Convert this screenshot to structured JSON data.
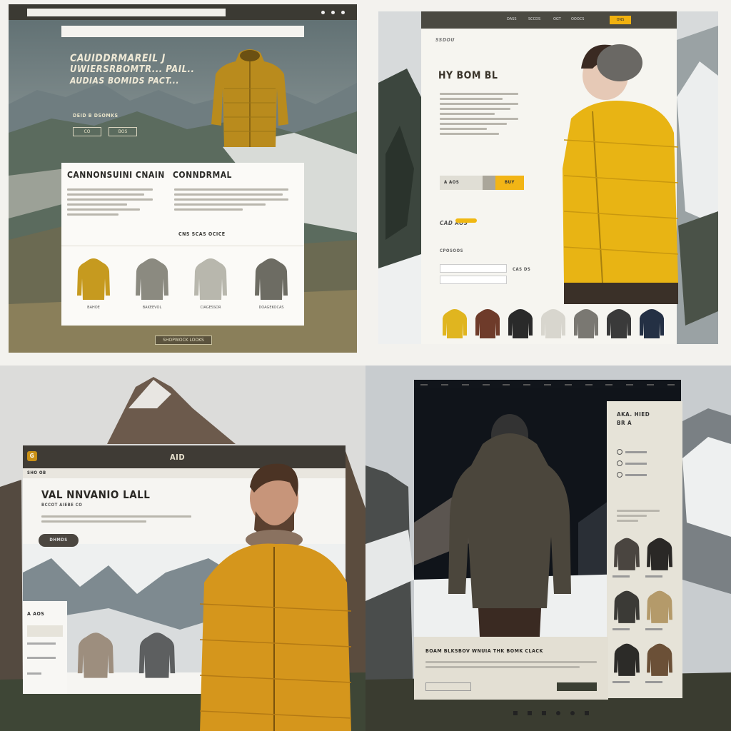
{
  "q1": {
    "browser_url": "",
    "nav_logo": "",
    "nav_items": [
      "",
      "",
      "",
      "",
      "",
      ""
    ],
    "nav_right": "",
    "hero_headline_1": "CAUIDDRMAREIL J",
    "hero_headline_2": "UWIERSRBOMTR... PAIL..",
    "hero_headline_3": "AUDIAS BOMIDS PACT...",
    "hero_sub": "DEID B DSOMKS",
    "hero_btn_1": "CO",
    "hero_btn_2": "BOS",
    "card_title_1": "CANNONSUINI CNAIN",
    "card_title_2": "CONNDRMAL",
    "card_link": "CNS SCAS OCICE",
    "products": [
      {
        "label": "BAHOE",
        "color": "#c69a1f"
      },
      {
        "label": "BAKEEVOL",
        "color": "#8b8a80"
      },
      {
        "label": "CIAGESSOR",
        "color": "#b8b7ad"
      },
      {
        "label": "DOAGEKOCAS",
        "color": "#6d6c63"
      }
    ],
    "footer_btn": "SHOPWOCK LOOKS"
  },
  "q2": {
    "topbar_items": [
      "DASS",
      "SCCDS",
      "OGT",
      "OOOCS"
    ],
    "topbar_cta": "ONS",
    "logo": "SSDOU",
    "headline": "HY BOM BL",
    "price_1": "A   AOS",
    "button_label": "BUY",
    "price_2": "CAD AOS",
    "tag": "CPOSOOS",
    "input_1": "",
    "input_2": "",
    "btn_2": "CAS DS",
    "thumbs": [
      {
        "color": "#e0b51f"
      },
      {
        "color": "#6e3b2a"
      },
      {
        "color": "#2a2a2a"
      },
      {
        "color": "#d8d6ce"
      },
      {
        "color": "#7a7872"
      },
      {
        "color": "#3a3a3a"
      },
      {
        "color": "#243044"
      }
    ]
  },
  "q3": {
    "window_logo": "G",
    "window_title": "AID",
    "window_subtitle": "",
    "nav_items": [
      "",
      "",
      "",
      "",
      "",
      "",
      ""
    ],
    "sidebar_title": "SHO OB",
    "headline": "VAL NNVANIO LALL",
    "sub": "BCCOT AIEBE CO",
    "cta": "DHMDS",
    "panel_title": "A  AOS",
    "panel_links": [
      "",
      "",
      ""
    ]
  },
  "q4": {
    "top_nav": [
      "",
      "",
      "",
      "",
      "",
      "",
      "",
      "",
      "",
      "",
      "",
      "",
      ""
    ],
    "side_title": "AKA. HIED",
    "side_sub": "BR A",
    "side_icons": [
      "",
      "",
      ""
    ],
    "side_links": [
      "",
      "",
      ""
    ],
    "side_products": [
      {
        "label": "",
        "color": "#4a4540"
      },
      {
        "label": "",
        "color": "#2a2826"
      },
      {
        "label": "",
        "color": "#3b3a36"
      },
      {
        "label": "",
        "color": "#b49a6a"
      },
      {
        "label": "",
        "color": "#2c2b28"
      },
      {
        "label": "",
        "color": "#6b5037"
      }
    ],
    "bottom_title": "BOAM BLKSBOV WNUIA THK BOMK CLACK",
    "bottom_btn": "",
    "bottom_btn_2": "",
    "footer_icons": [
      "",
      "",
      "",
      "",
      "",
      ""
    ]
  }
}
